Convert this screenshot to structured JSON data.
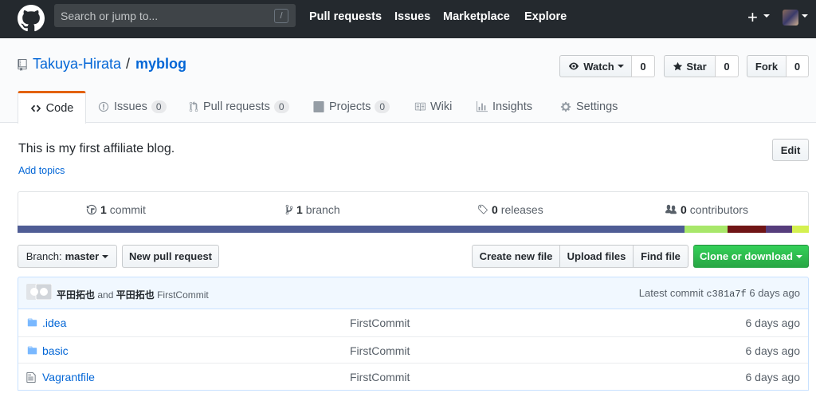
{
  "header": {
    "search_placeholder": "Search or jump to...",
    "slash_key": "/",
    "nav": [
      "Pull requests",
      "Issues",
      "Marketplace",
      "Explore"
    ],
    "plus_label": "+"
  },
  "repo": {
    "owner": "Takuya-Hirata",
    "separator": "/",
    "name": "myblog",
    "watch_label": "Watch",
    "watch_count": "0",
    "star_label": "Star",
    "star_count": "0",
    "fork_label": "Fork",
    "fork_count": "0"
  },
  "tabs": [
    {
      "label": "Code",
      "count": null
    },
    {
      "label": "Issues",
      "count": "0"
    },
    {
      "label": "Pull requests",
      "count": "0"
    },
    {
      "label": "Projects",
      "count": "0"
    },
    {
      "label": "Wiki",
      "count": null
    },
    {
      "label": "Insights",
      "count": null
    },
    {
      "label": "Settings",
      "count": null
    }
  ],
  "description": "This is my first affiliate blog.",
  "edit_label": "Edit",
  "add_topics": "Add topics",
  "summary": {
    "commits_num": "1",
    "commits_label": "commit",
    "branches_num": "1",
    "branches_label": "branch",
    "releases_num": "0",
    "releases_label": "releases",
    "contributors_num": "0",
    "contributors_label": "contributors"
  },
  "language_colors": [
    "#4F5D95",
    "#A8E76A",
    "#701516",
    "#563d7c",
    "#D4F050"
  ],
  "language_shares": [
    0.843,
    0.054,
    0.049,
    0.033,
    0.021
  ],
  "toolbar": {
    "branch_prefix": "Branch:",
    "branch_name": "master",
    "new_pr": "New pull request",
    "create_file": "Create new file",
    "upload_files": "Upload files",
    "find_file": "Find file",
    "clone": "Clone or download"
  },
  "commit": {
    "author1": "平田拓也",
    "and": "and",
    "author2": "平田拓也",
    "message": "FirstCommit",
    "latest_label": "Latest commit",
    "sha": "c381a7f",
    "age": "6 days ago"
  },
  "files": [
    {
      "name": ".idea",
      "type": "folder",
      "message": "FirstCommit",
      "age": "6 days ago"
    },
    {
      "name": "basic",
      "type": "folder",
      "message": "FirstCommit",
      "age": "6 days ago"
    },
    {
      "name": "Vagrantfile",
      "type": "file",
      "message": "FirstCommit",
      "age": "6 days ago"
    }
  ],
  "colors": {
    "header_bg": "#24292e",
    "link": "#0366d6",
    "tab_accent": "#e36209",
    "green_button": "#28a745"
  }
}
